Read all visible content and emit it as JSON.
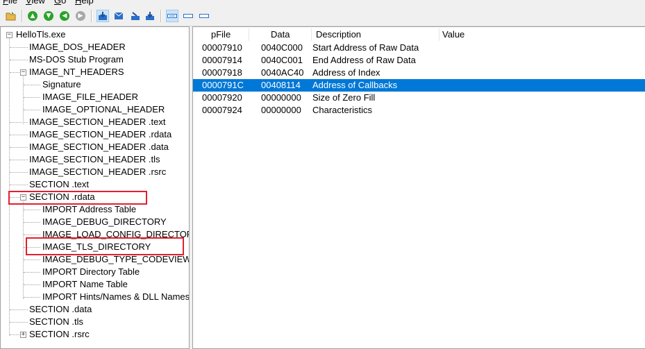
{
  "menu": {
    "file": "File",
    "view": "View",
    "go": "Go",
    "help": "Help"
  },
  "toolbar": {
    "open_icon": "open-folder-icon",
    "nav": [
      "up-icon",
      "down-icon",
      "back-icon",
      "forward-icon"
    ],
    "tools": [
      "save-icon",
      "mail-icon",
      "import-icon",
      "export-icon"
    ],
    "views": [
      "view-1-icon",
      "view-2-icon",
      "view-3-icon"
    ]
  },
  "tree": {
    "root": "HelloTls.exe",
    "items": [
      "IMAGE_DOS_HEADER",
      "MS-DOS Stub Program",
      "IMAGE_NT_HEADERS",
      "Signature",
      "IMAGE_FILE_HEADER",
      "IMAGE_OPTIONAL_HEADER",
      "IMAGE_SECTION_HEADER .text",
      "IMAGE_SECTION_HEADER .rdata",
      "IMAGE_SECTION_HEADER .data",
      "IMAGE_SECTION_HEADER .tls",
      "IMAGE_SECTION_HEADER .rsrc",
      "SECTION .text",
      "SECTION .rdata",
      "IMPORT Address Table",
      "IMAGE_DEBUG_DIRECTORY",
      "IMAGE_LOAD_CONFIG_DIRECTORY",
      "IMAGE_TLS_DIRECTORY",
      "IMAGE_DEBUG_TYPE_CODEVIEW",
      "IMPORT Directory Table",
      "IMPORT Name Table",
      "IMPORT Hints/Names & DLL Names",
      "SECTION .data",
      "SECTION .tls",
      "SECTION .rsrc"
    ]
  },
  "list": {
    "columns": [
      "pFile",
      "Data",
      "Description",
      "Value"
    ],
    "rows": [
      {
        "pfile": "00007910",
        "data": "0040C000",
        "description": "Start Address of Raw Data",
        "value": ""
      },
      {
        "pfile": "00007914",
        "data": "0040C001",
        "description": "End Address of Raw Data",
        "value": ""
      },
      {
        "pfile": "00007918",
        "data": "0040AC40",
        "description": "Address of Index",
        "value": ""
      },
      {
        "pfile": "0000791C",
        "data": "00408114",
        "description": "Address of Callbacks",
        "value": ""
      },
      {
        "pfile": "00007920",
        "data": "00000000",
        "description": "Size of Zero Fill",
        "value": ""
      },
      {
        "pfile": "00007924",
        "data": "00000000",
        "description": "Characteristics",
        "value": ""
      }
    ],
    "selected_index": 3
  },
  "colors": {
    "selection": "#0078d7",
    "highlight_box": "#e0202e"
  }
}
